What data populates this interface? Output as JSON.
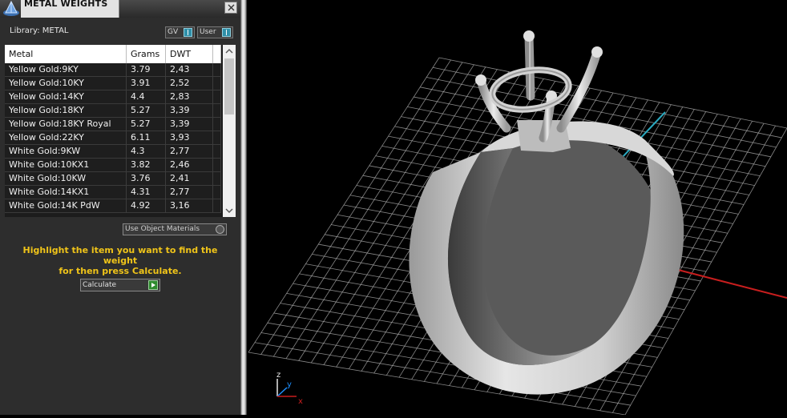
{
  "window": {
    "title": "METAL WEIGHTS",
    "library_label": "Library: METAL",
    "toggles": {
      "gv": "GV",
      "user": "User"
    }
  },
  "table": {
    "columns": [
      "Metal",
      "Grams",
      "DWT"
    ],
    "rows": [
      {
        "metal": "Yellow Gold:9KY",
        "grams": "3.79",
        "dwt": "2,43"
      },
      {
        "metal": "Yellow Gold:10KY",
        "grams": "3.91",
        "dwt": "2,52"
      },
      {
        "metal": "Yellow Gold:14KY",
        "grams": "4.4",
        "dwt": "2,83"
      },
      {
        "metal": "Yellow Gold:18KY",
        "grams": "5.27",
        "dwt": "3,39"
      },
      {
        "metal": "Yellow Gold:18KY Royal",
        "grams": "5.27",
        "dwt": "3,39"
      },
      {
        "metal": "Yellow Gold:22KY",
        "grams": "6.11",
        "dwt": "3,93"
      },
      {
        "metal": "White Gold:9KW",
        "grams": "4.3",
        "dwt": "2,77"
      },
      {
        "metal": "White Gold:10KX1",
        "grams": "3.82",
        "dwt": "2,46"
      },
      {
        "metal": "White Gold:10KW",
        "grams": "3.76",
        "dwt": "2,41"
      },
      {
        "metal": "White Gold:14KX1",
        "grams": "4.31",
        "dwt": "2,77"
      },
      {
        "metal": "White Gold:14K PdW",
        "grams": "4.92",
        "dwt": "3,16"
      }
    ]
  },
  "use_object_materials_label": "Use Object Materials",
  "hint_line1": "Highlight the item you want to find the weight",
  "hint_line2": "for then press Calculate.",
  "calculate_label": "Calculate",
  "viewport": {
    "axis_labels": {
      "x": "x",
      "y": "y",
      "z": "z"
    },
    "colors": {
      "grid": "#b4b4b4",
      "x_axis": "#c81e1e",
      "y_axis": "#2aa9c0",
      "ring": "#bdbdbd"
    }
  },
  "colors": {
    "hint": "#f0c419",
    "panel_bg": "#2d2d2d",
    "accent_toggle": "#2f8fa8",
    "calc_arrow": "#2e8b2e"
  }
}
